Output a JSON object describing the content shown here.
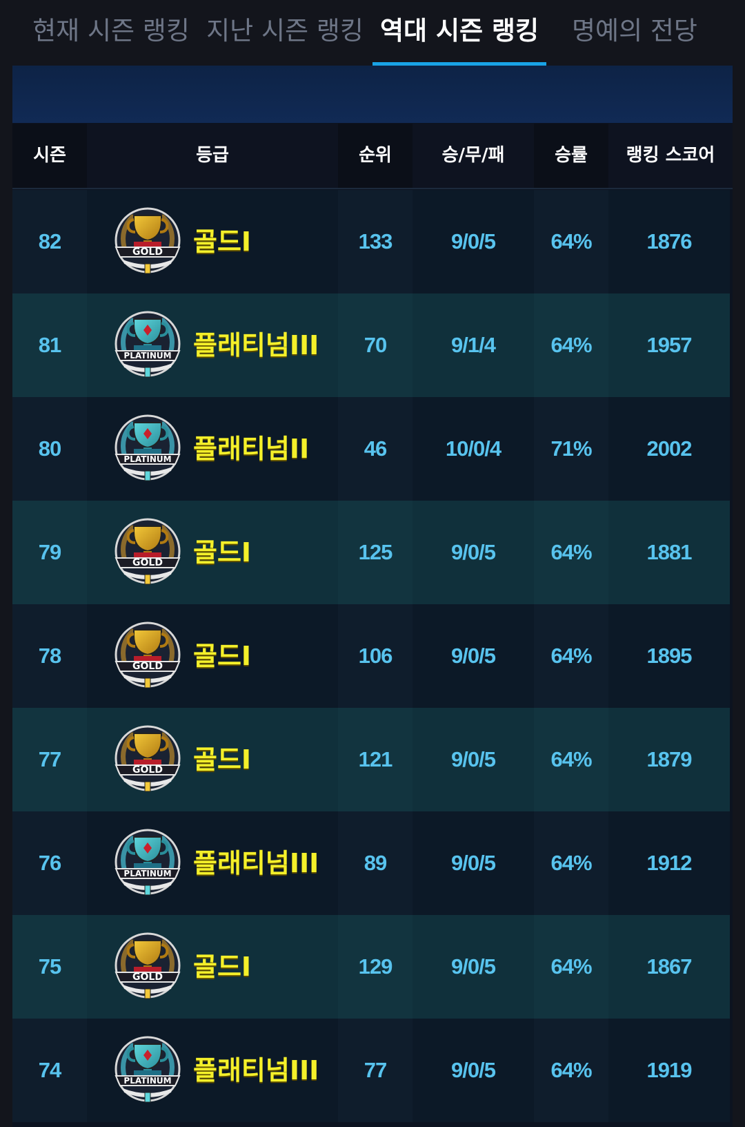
{
  "tabs": [
    {
      "label": "현재 시즌 랭킹",
      "active": false
    },
    {
      "label": "지난 시즌 랭킹",
      "active": false
    },
    {
      "label": "역대 시즌 랭킹",
      "active": true
    },
    {
      "label": "명예의 전당",
      "active": false
    }
  ],
  "table": {
    "headers": [
      "시즌",
      "등급",
      "순위",
      "승/무/패",
      "승률",
      "랭킹 스코어"
    ],
    "rows": [
      {
        "season": "82",
        "badge": "gold-trophy-badge",
        "badge_text": "GOLD",
        "grade": "골드I",
        "rank": "133",
        "record": "9/0/5",
        "win_rate": "64%",
        "score": "1876"
      },
      {
        "season": "81",
        "badge": "platinum-trophy-badge",
        "badge_text": "PLATINUM",
        "grade": "플래티넘III",
        "rank": "70",
        "record": "9/1/4",
        "win_rate": "64%",
        "score": "1957"
      },
      {
        "season": "80",
        "badge": "platinum-trophy-badge",
        "badge_text": "PLATINUM",
        "grade": "플래티넘II",
        "rank": "46",
        "record": "10/0/4",
        "win_rate": "71%",
        "score": "2002"
      },
      {
        "season": "79",
        "badge": "gold-trophy-badge",
        "badge_text": "GOLD",
        "grade": "골드I",
        "rank": "125",
        "record": "9/0/5",
        "win_rate": "64%",
        "score": "1881"
      },
      {
        "season": "78",
        "badge": "gold-trophy-badge",
        "badge_text": "GOLD",
        "grade": "골드I",
        "rank": "106",
        "record": "9/0/5",
        "win_rate": "64%",
        "score": "1895"
      },
      {
        "season": "77",
        "badge": "gold-trophy-badge",
        "badge_text": "GOLD",
        "grade": "골드I",
        "rank": "121",
        "record": "9/0/5",
        "win_rate": "64%",
        "score": "1879"
      },
      {
        "season": "76",
        "badge": "platinum-trophy-badge",
        "badge_text": "PLATINUM",
        "grade": "플래티넘III",
        "rank": "89",
        "record": "9/0/5",
        "win_rate": "64%",
        "score": "1912"
      },
      {
        "season": "75",
        "badge": "gold-trophy-badge",
        "badge_text": "GOLD",
        "grade": "골드I",
        "rank": "129",
        "record": "9/0/5",
        "win_rate": "64%",
        "score": "1867"
      },
      {
        "season": "74",
        "badge": "platinum-trophy-badge",
        "badge_text": "PLATINUM",
        "grade": "플래티넘III",
        "rank": "77",
        "record": "9/0/5",
        "win_rate": "64%",
        "score": "1919"
      }
    ]
  },
  "colors": {
    "accent": "#19a3e6",
    "value_text": "#58c3ee",
    "grade_text": "#f4f02a",
    "row_dark": "#0f1d2c",
    "row_teal": "#12343f",
    "banner": "#0d2346"
  }
}
